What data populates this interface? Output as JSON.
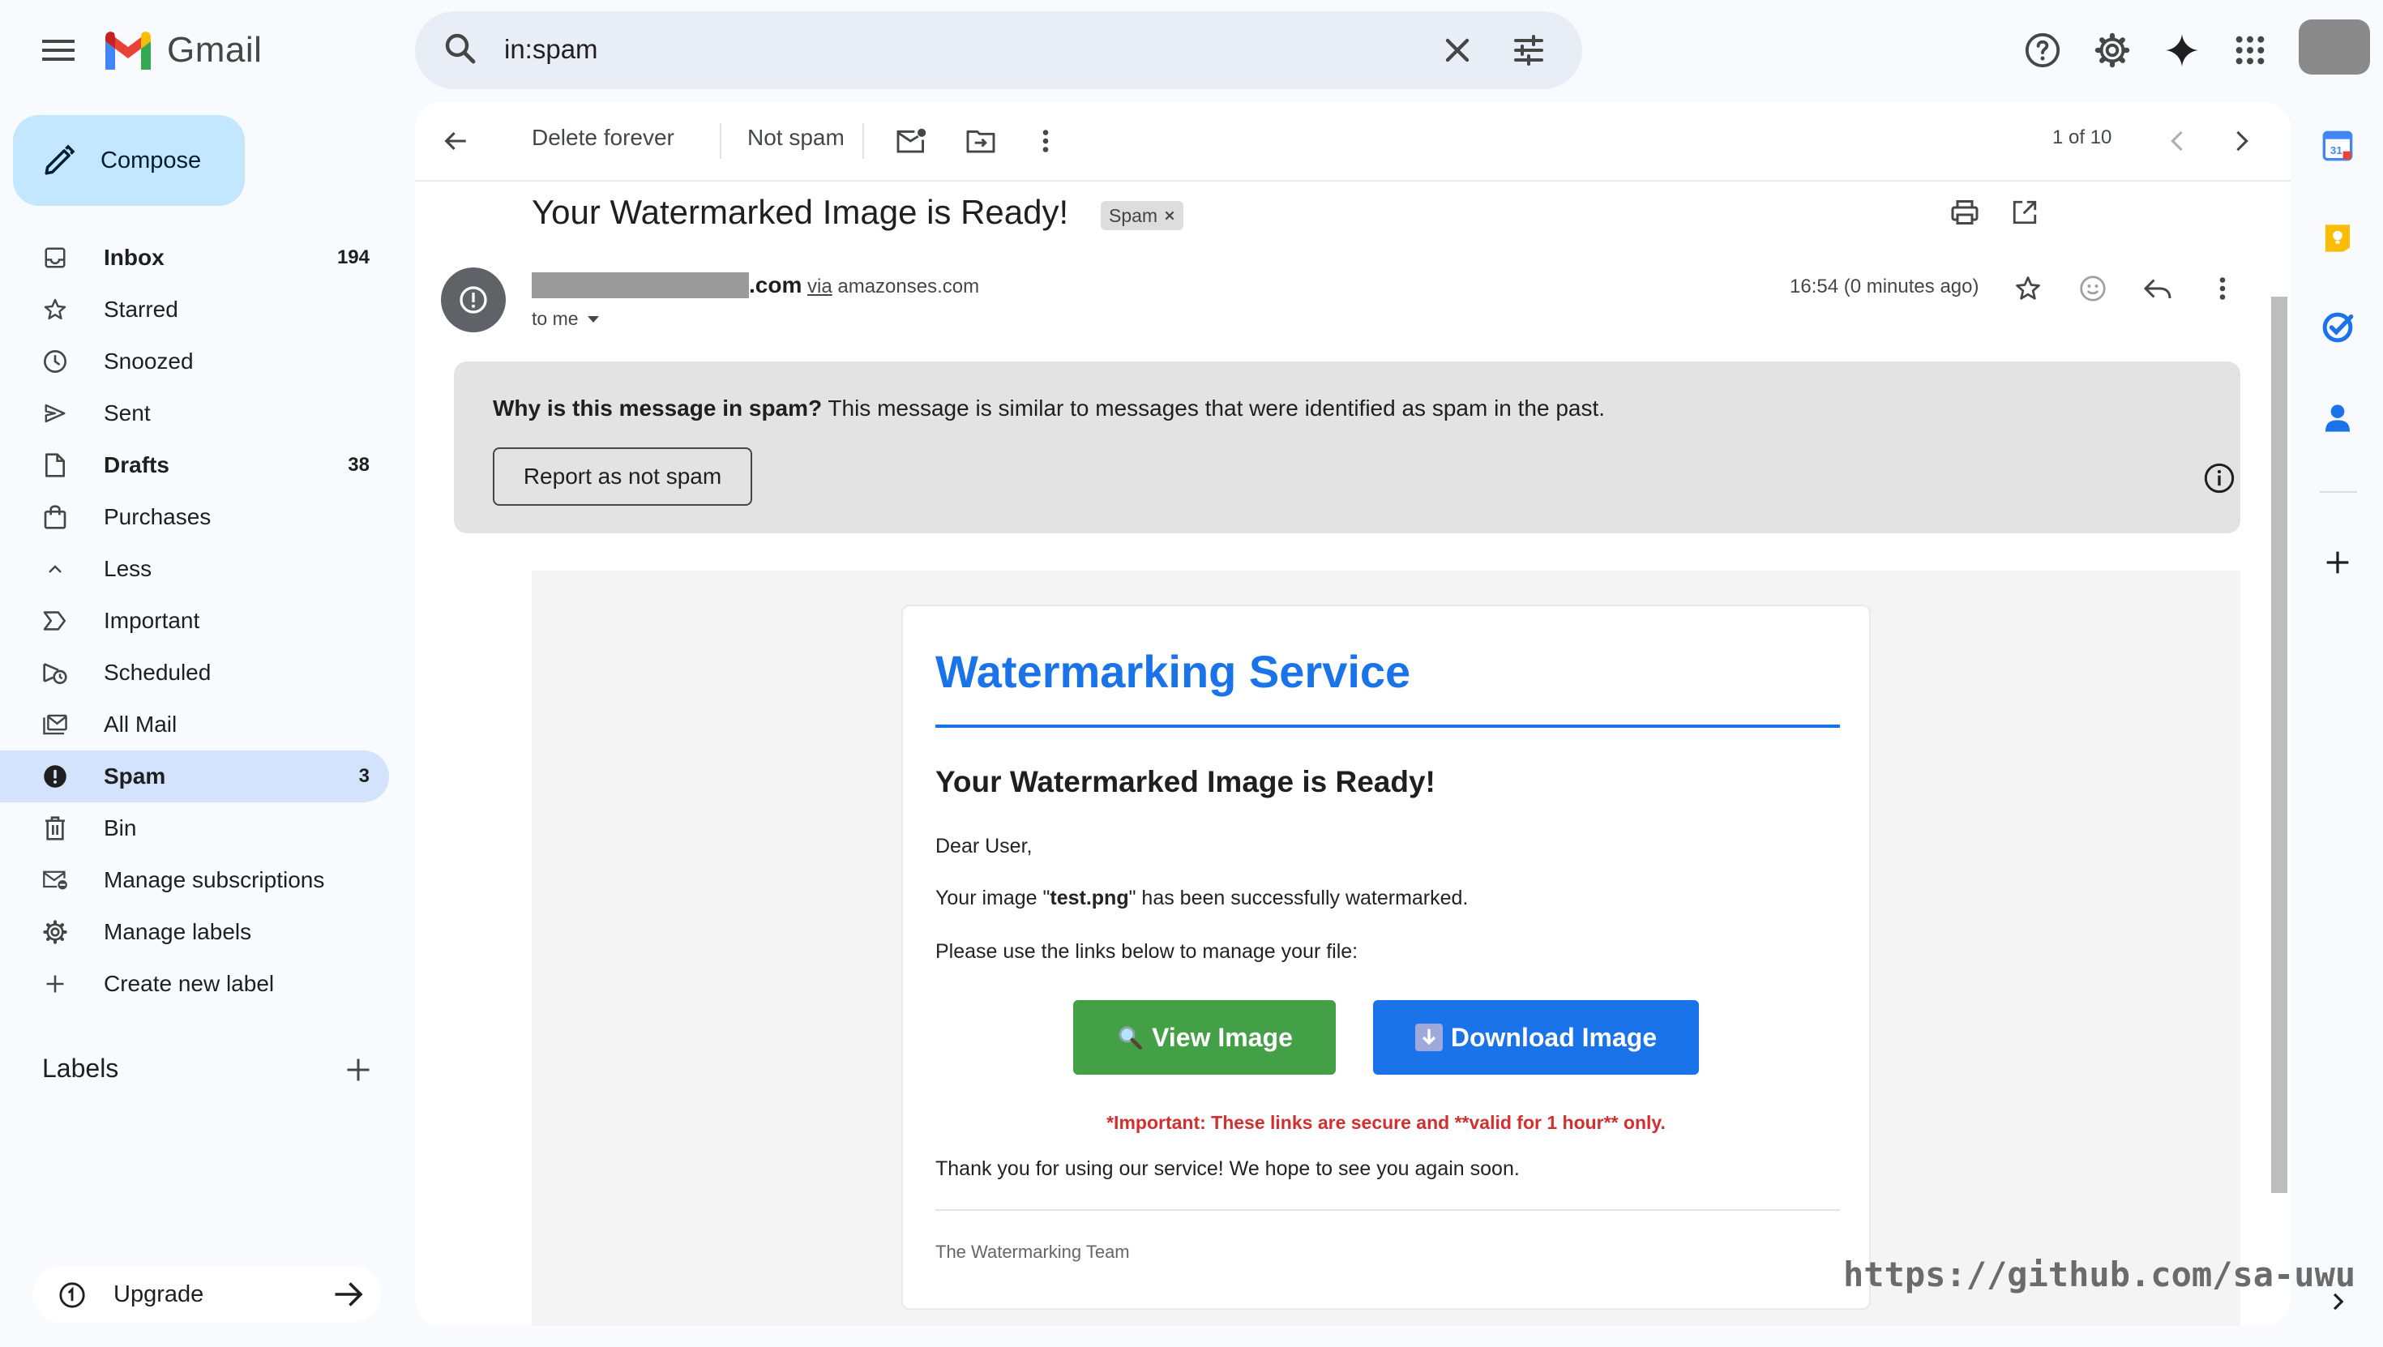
{
  "header": {
    "app_name": "Gmail",
    "search_value": "in:spam",
    "icons": [
      "main-menu-icon",
      "search-icon",
      "clear-search-icon",
      "search-options-icon",
      "help-icon",
      "settings-icon",
      "gemini-icon",
      "apps-icon",
      "account-avatar"
    ]
  },
  "nav": {
    "compose_label": "Compose",
    "items": [
      {
        "label": "Inbox",
        "count": "194",
        "icon": "inbox-icon",
        "bold": true
      },
      {
        "label": "Starred",
        "count": "",
        "icon": "star-icon"
      },
      {
        "label": "Snoozed",
        "count": "",
        "icon": "clock-icon"
      },
      {
        "label": "Sent",
        "count": "",
        "icon": "send-icon"
      },
      {
        "label": "Drafts",
        "count": "38",
        "icon": "draft-icon",
        "bold": true
      },
      {
        "label": "Purchases",
        "count": "",
        "icon": "shopping-bag-icon"
      },
      {
        "label": "Less",
        "count": "",
        "icon": "chevron-up-icon"
      },
      {
        "label": "Important",
        "count": "",
        "icon": "important-icon"
      },
      {
        "label": "Scheduled",
        "count": "",
        "icon": "scheduled-send-icon"
      },
      {
        "label": "All Mail",
        "count": "",
        "icon": "all-mail-icon"
      },
      {
        "label": "Spam",
        "count": "3",
        "icon": "spam-icon",
        "bold": true,
        "active": true
      },
      {
        "label": "Bin",
        "count": "",
        "icon": "trash-icon"
      },
      {
        "label": "Manage subscriptions",
        "count": "",
        "icon": "manage-subscriptions-icon"
      },
      {
        "label": "Manage labels",
        "count": "",
        "icon": "gear-icon"
      },
      {
        "label": "Create new label",
        "count": "",
        "icon": "plus-icon"
      }
    ],
    "labels_header": "Labels",
    "upgrade_label": "Upgrade"
  },
  "toolbar": {
    "delete_forever": "Delete forever",
    "not_spam": "Not spam",
    "pager": "1 of 10"
  },
  "message": {
    "subject": "Your Watermarked Image is Ready!",
    "chip": "Spam",
    "sender_domain": ".com",
    "via_word": "via",
    "via_domain": "amazonses.com",
    "to": "to me",
    "time": "16:54 (0 minutes ago)"
  },
  "spam_notice": {
    "question": "Why is this message in spam?",
    "explanation": " This message is similar to messages that were identified as spam in the past.",
    "report_button": "Report as not spam"
  },
  "email_body": {
    "title": "Watermarking Service",
    "heading": "Your Watermarked Image is Ready!",
    "greeting": "Dear User,",
    "line1_pre": "Your image \"",
    "line1_file": "test.png",
    "line1_post": "\" has been successfully watermarked.",
    "line2": "Please use the links below to manage your file:",
    "view_button": "View Image",
    "download_button": "Download Image",
    "important": "*Important: These links are secure and **valid for 1 hour** only.",
    "thanks": "Thank you for using our service! We hope to see you again soon.",
    "signature": "The Watermarking Team"
  },
  "side_panel": {
    "calendar_day": "31",
    "icons": [
      "calendar-icon",
      "keep-icon",
      "tasks-icon",
      "contacts-icon",
      "add-addon-icon",
      "expand-side-panel-icon"
    ]
  },
  "watermark_text": "https://github.com/sa-uwu"
}
